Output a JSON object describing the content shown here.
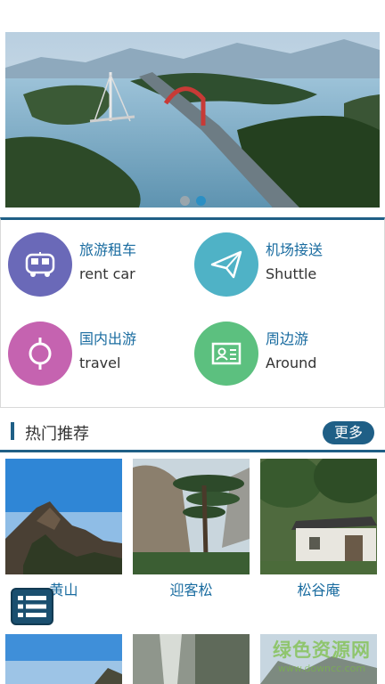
{
  "banner": {
    "image": "lake-bridge-landscape",
    "slides": 2,
    "active_slide": 2
  },
  "services": [
    {
      "name": "rent-car",
      "cn": "旅游租车",
      "en": "rent car",
      "icon": "bus-icon",
      "color": "#6a69b8"
    },
    {
      "name": "shuttle",
      "cn": "机场接送",
      "en": "Shuttle",
      "icon": "paper-plane-icon",
      "color": "#4fb2c6"
    },
    {
      "name": "travel",
      "cn": "国内出游",
      "en": "travel",
      "icon": "compass-ring-icon",
      "color": "#c563b0"
    },
    {
      "name": "around",
      "cn": "周边游",
      "en": "Around",
      "icon": "id-card-icon",
      "color": "#5cc07f"
    }
  ],
  "hot": {
    "title": "热门推荐",
    "more_label": "更多",
    "items": [
      {
        "name": "黄山",
        "image": "mountain-peak-photo"
      },
      {
        "name": "迎客松",
        "image": "welcoming-pine-photo"
      },
      {
        "name": "松谷庵",
        "image": "temple-photo"
      }
    ]
  },
  "fab": {
    "icon": "list-menu-icon"
  },
  "watermark": {
    "text": "绿色资源网",
    "url": "www.downcc.com"
  }
}
